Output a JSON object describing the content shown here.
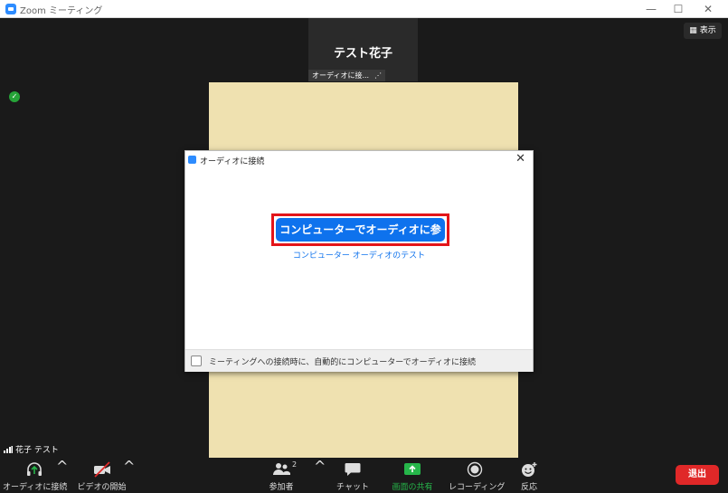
{
  "window": {
    "title": "Zoom ミーティング",
    "minimize": "—",
    "maximize": "☐",
    "close": "✕"
  },
  "video": {
    "speaker_name": "テスト花子",
    "audio_chip": "オーディオに接...",
    "view_label": "表示",
    "participant_label": "花子 テスト"
  },
  "dialog": {
    "title": "オーディオに接続",
    "join_button": "コンピューターでオーディオに参加",
    "test_link": "コンピューター オーディオのテスト",
    "auto_join_label": "ミーティングへの接続時に、自動的にコンピューターでオーディオに接続",
    "auto_join_checked": false
  },
  "toolbar": {
    "audio": "オーディオに接続",
    "video": "ビデオの開始",
    "participants": "参加者",
    "participants_count": "2",
    "chat": "チャット",
    "share": "画面の共有",
    "record": "レコーディング",
    "reactions": "反応",
    "end": "退出"
  },
  "colors": {
    "zoom_blue": "#0e72ed",
    "share_green": "#26b64a",
    "end_red": "#e02828",
    "highlight_red": "#e3151a"
  }
}
